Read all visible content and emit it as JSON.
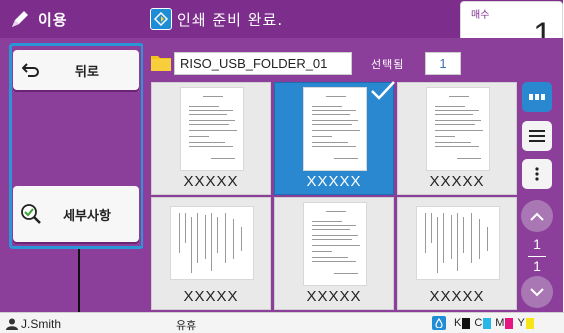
{
  "header": {
    "left_title": "이용",
    "status_text": "인쇄 준비 완료.",
    "copies_label": "매수",
    "copies_value": "1"
  },
  "sidebar": {
    "back_label": "뒤로",
    "details_label": "세부사항"
  },
  "folder": {
    "name": "RISO_USB_FOLDER_01",
    "selected_label": "선택됨",
    "selected_count": "1"
  },
  "thumbnails": [
    {
      "name": "XXXXX",
      "selected": false,
      "orientation": "portrait"
    },
    {
      "name": "XXXXX",
      "selected": true,
      "orientation": "portrait"
    },
    {
      "name": "XXXXX",
      "selected": false,
      "orientation": "portrait"
    },
    {
      "name": "XXXXX",
      "selected": false,
      "orientation": "landscape"
    },
    {
      "name": "XXXXX",
      "selected": false,
      "orientation": "portrait"
    },
    {
      "name": "XXXXX",
      "selected": false,
      "orientation": "landscape"
    }
  ],
  "pager": {
    "current": "1",
    "total": "1"
  },
  "view_modes": {
    "active": "thumbnail-view-icon"
  },
  "footer": {
    "user": "J.Smith",
    "status": "유휴",
    "inks": [
      {
        "label": "K",
        "color": "#111111"
      },
      {
        "label": "C",
        "color": "#29b6e8"
      },
      {
        "label": "M",
        "color": "#e6157f"
      },
      {
        "label": "Y",
        "color": "#f6e51a"
      }
    ]
  },
  "colors": {
    "accent_purple": "#7d2d8c",
    "panel_purple": "#8c3f9a",
    "selection_blue": "#2a88d0"
  }
}
